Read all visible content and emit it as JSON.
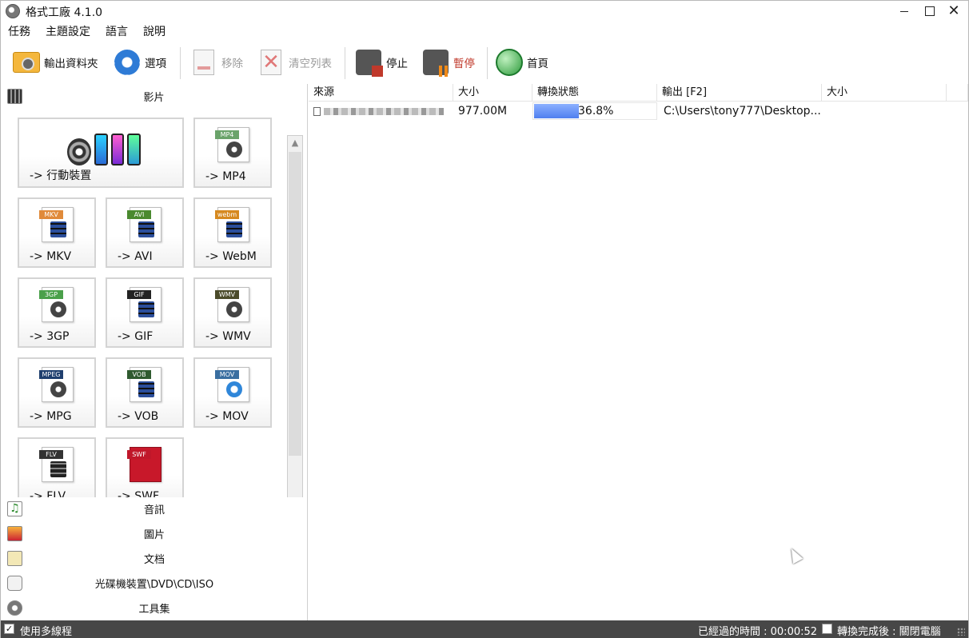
{
  "window": {
    "title": "格式工廠 4.1.0"
  },
  "menu": [
    "任務",
    "主題設定",
    "語言",
    "說明"
  ],
  "toolbar": {
    "output_folder": "輸出資料夾",
    "options": "選項",
    "remove": "移除",
    "clear_list": "清空列表",
    "stop": "停止",
    "pause": "暫停",
    "home": "首頁"
  },
  "sections": {
    "video": "影片",
    "audio": "音訊",
    "image": "圖片",
    "document": "文档",
    "disc": "光碟機裝置\\DVD\\CD\\ISO",
    "tools": "工具集"
  },
  "video_tiles": [
    {
      "label": "-> 行動裝置"
    },
    {
      "label": "-> MP4",
      "tag": "MP4",
      "tag_color": "#6aa36a"
    },
    {
      "label": "-> MKV",
      "tag": "MKV",
      "tag_color": "#e08a3a"
    },
    {
      "label": "-> AVI",
      "tag": "AVI",
      "tag_color": "#4a8a2f"
    },
    {
      "label": "-> WebM",
      "tag": "webm",
      "tag_color": "#d6891f"
    },
    {
      "label": "-> 3GP",
      "tag": "3GP",
      "tag_color": "#4aa04a"
    },
    {
      "label": "-> GIF",
      "tag": "GIF",
      "tag_color": "#222222"
    },
    {
      "label": "-> WMV",
      "tag": "WMV",
      "tag_color": "#4b4b2a"
    },
    {
      "label": "-> MPG",
      "tag": "MPEG",
      "tag_color": "#1f3f6e"
    },
    {
      "label": "-> VOB",
      "tag": "VOB",
      "tag_color": "#2f5a2f"
    },
    {
      "label": "-> MOV",
      "tag": "MOV",
      "tag_color": "#3a6ea0"
    },
    {
      "label": "-> FLV",
      "tag": "FLV",
      "tag_color": "#333333"
    },
    {
      "label": "-> SWF",
      "tag": "SWF",
      "tag_color": "#c0172a"
    }
  ],
  "list": {
    "columns": [
      "來源",
      "大小",
      "轉換狀態",
      "輸出 [F2]",
      "大小"
    ],
    "rows": [
      {
        "size": "977.00M",
        "progress": 36.8,
        "progress_text": "36.8%",
        "output": "C:\\Users\\tony777\\Desktop..."
      }
    ]
  },
  "status": {
    "multithread": "使用多線程",
    "multithread_checked": true,
    "elapsed": "已經過的時間 : 00:00:52",
    "after_done": "轉換完成後 : 關閉電腦",
    "after_checked": false
  }
}
